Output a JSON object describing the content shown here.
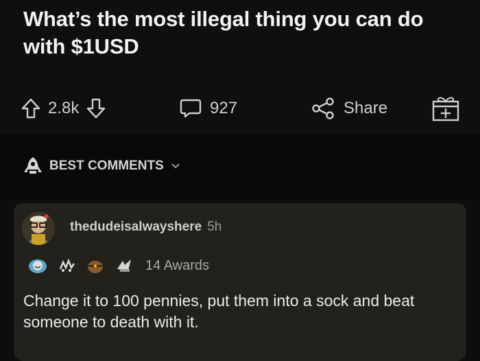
{
  "post": {
    "title": "What’s the most illegal thing you can do\nwith $1USD",
    "upvotes": "2.8k",
    "comments_count": "927",
    "share_label": "Share"
  },
  "sort": {
    "label": "BEST COMMENTS"
  },
  "comment": {
    "author": "thedudeisalwayshere",
    "age": "5h",
    "awards_label": "14 Awards",
    "body": "Change it to 100 pennies, put them into a sock and beat someone to death with it."
  },
  "colors": {
    "background": "#0d0d0d",
    "card": "#23211c",
    "text": "#e6e6e6",
    "muted": "#9a9a9a"
  },
  "icons": {
    "upvote": "arrow-up-icon",
    "downvote": "arrow-down-icon",
    "comments": "speech-bubble-icon",
    "share": "share-icon",
    "award": "gift-award-icon",
    "sort": "rocket-icon",
    "chevron": "chevron-down-icon"
  }
}
